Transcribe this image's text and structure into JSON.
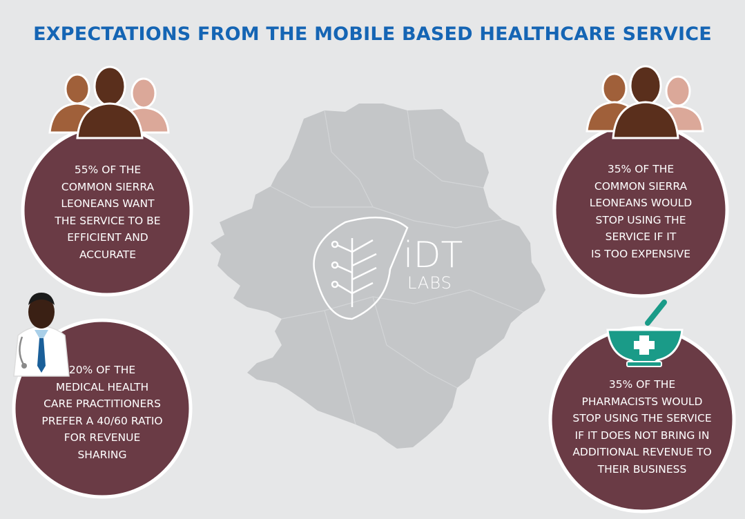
{
  "title": "EXPECTATIONS FROM THE MOBILE BASED HEALTHCARE SERVICE",
  "logo": {
    "line1": "iDT",
    "line2": "LABS"
  },
  "stats": [
    {
      "lines": [
        "55% OF THE",
        "COMMON SIERRA",
        "LEONEANS WANT",
        "THE SERVICE TO BE",
        "EFFICIENT AND",
        "ACCURATE"
      ],
      "icon": "people-group-icon"
    },
    {
      "lines": [
        "35% OF THE",
        "COMMON SIERRA",
        "LEONEANS WOULD",
        "STOP USING THE",
        "SERVICE  IF  IT",
        "IS TOO EXPENSIVE"
      ],
      "icon": "people-group-icon"
    },
    {
      "lines": [
        "20% OF THE",
        "MEDICAL HEALTH",
        "CARE PRACTITIONERS",
        "PREFER A 40/60 RATIO",
        "FOR REVENUE",
        "SHARING"
      ],
      "icon": "doctor-icon"
    },
    {
      "lines": [
        "35% OF THE",
        "PHARMACISTS WOULD",
        "STOP USING THE SERVICE",
        "IF IT DOES NOT BRING IN",
        "ADDITIONAL REVENUE TO",
        "THEIR BUSINESS"
      ],
      "icon": "pharmacy-mortar-icon"
    }
  ],
  "colors": {
    "title": "#1565b4",
    "circle": "#6a3b45",
    "map": "#c4c6c8",
    "background": "#e6e7e8",
    "pharmacy": "#1a9b88"
  }
}
